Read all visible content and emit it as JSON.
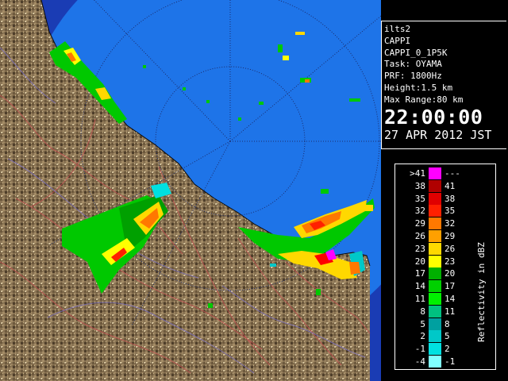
{
  "info": {
    "lines": [
      "ilts2",
      "CAPPI",
      "CAPPI_0_1P5K",
      "Task: OYAMA",
      "PRF: 1800Hz",
      "Height:1.5 km",
      "Max Range:80 km"
    ],
    "time": "22:00:00",
    "date": "27 APR 2012 JST"
  },
  "legend": {
    "title": "Reflectivity in dBZ",
    "rows": [
      {
        "min": ">41",
        "max": "---",
        "color": "#ff00ff"
      },
      {
        "min": "38",
        "max": "41",
        "color": "#b00000"
      },
      {
        "min": "35",
        "max": "38",
        "color": "#e00000"
      },
      {
        "min": "32",
        "max": "35",
        "color": "#ff2000"
      },
      {
        "min": "29",
        "max": "32",
        "color": "#ff7800"
      },
      {
        "min": "26",
        "max": "29",
        "color": "#ffa000"
      },
      {
        "min": "23",
        "max": "26",
        "color": "#ffd800"
      },
      {
        "min": "20",
        "max": "23",
        "color": "#ffff00"
      },
      {
        "min": "17",
        "max": "20",
        "color": "#00b000"
      },
      {
        "min": "14",
        "max": "17",
        "color": "#00d000"
      },
      {
        "min": "11",
        "max": "14",
        "color": "#00f000"
      },
      {
        "min": "8",
        "max": "11",
        "color": "#00c080"
      },
      {
        "min": "5",
        "max": "8",
        "color": "#00a0a0"
      },
      {
        "min": "2",
        "max": "5",
        "color": "#00c8c8"
      },
      {
        "min": "-1",
        "max": "2",
        "color": "#00e0e0"
      },
      {
        "min": "-4",
        "max": "-1",
        "color": "#80ffff"
      }
    ]
  },
  "colors": {
    "sea": "#1e74e8",
    "outer_sea": "#1a3cb4",
    "land": "#8a7454",
    "border_lines": "#c05050"
  }
}
